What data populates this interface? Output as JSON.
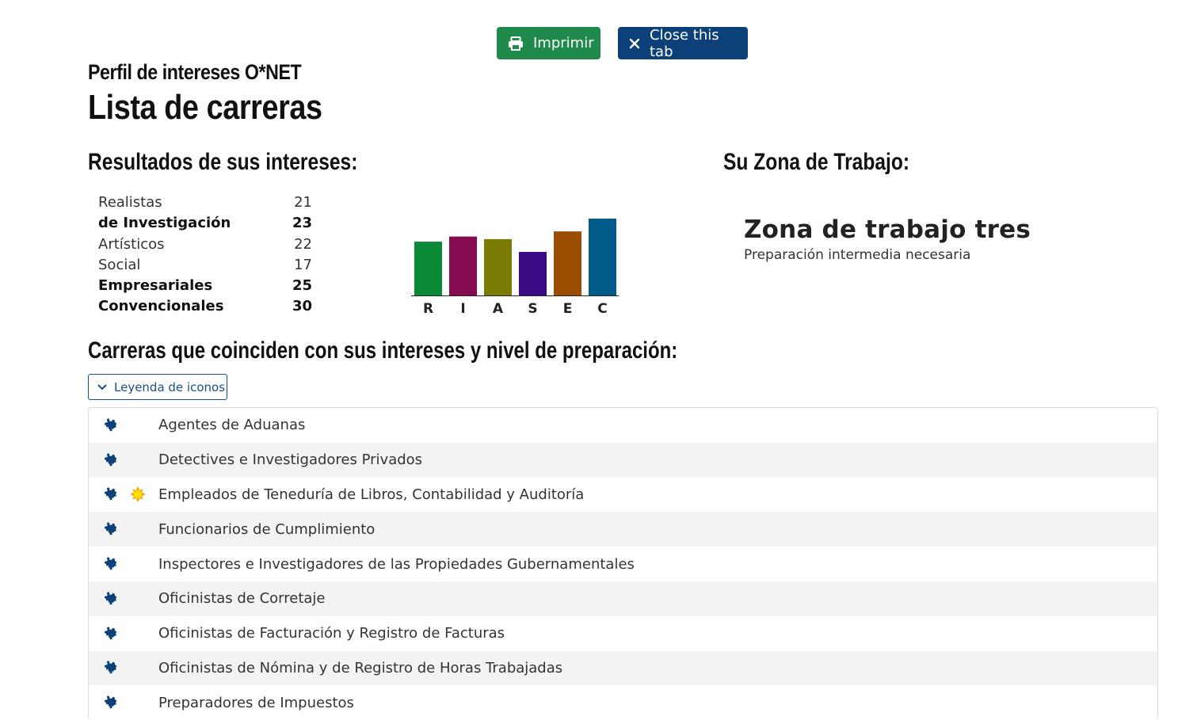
{
  "toolbar": {
    "print_label": "Imprimir",
    "close_label": "Close this tab"
  },
  "header": {
    "subtitle": "Perfil de intereses O*NET",
    "title": "Lista de carreras"
  },
  "results": {
    "heading": "Resultados de sus intereses:",
    "scores": [
      {
        "label": "Realistas",
        "value": "21",
        "bold": false
      },
      {
        "label": "de Investigación",
        "value": "23",
        "bold": true
      },
      {
        "label": "Artísticos",
        "value": "22",
        "bold": false
      },
      {
        "label": "Social",
        "value": "17",
        "bold": false
      },
      {
        "label": "Empresariales",
        "value": "25",
        "bold": true
      },
      {
        "label": "Convencionales",
        "value": "30",
        "bold": true
      }
    ]
  },
  "chart_data": {
    "type": "bar",
    "categories": [
      "R",
      "I",
      "A",
      "S",
      "E",
      "C"
    ],
    "values": [
      21,
      23,
      22,
      17,
      25,
      30
    ],
    "colors": [
      "#0a8a35",
      "#850a4f",
      "#7a7a05",
      "#3a0a85",
      "#9a4d00",
      "#005a8a"
    ],
    "ylim": [
      0,
      30
    ],
    "grid": false
  },
  "zone": {
    "heading": "Su Zona de Trabajo:",
    "title": "Zona de trabajo tres",
    "description": "Preparación intermedia necesaria"
  },
  "careers": {
    "heading": "Carreras que coinciden con sus intereses y nivel de preparación:",
    "legend_label": "Leyenda de iconos",
    "items": [
      {
        "label": "Agentes de Aduanas",
        "bright": false
      },
      {
        "label": "Detectives e Investigadores Privados",
        "bright": false
      },
      {
        "label": "Empleados de Teneduría de Libros, Contabilidad y Auditoría",
        "bright": true
      },
      {
        "label": "Funcionarios de Cumplimiento",
        "bright": false
      },
      {
        "label": "Inspectores e Investigadores de las Propiedades Gubernamentales",
        "bright": false
      },
      {
        "label": "Oficinistas de Corretaje",
        "bright": false
      },
      {
        "label": "Oficinistas de Facturación y Registro de Facturas",
        "bright": false
      },
      {
        "label": "Oficinistas de Nómina y de Registro de Horas Trabajadas",
        "bright": false
      },
      {
        "label": "Preparadores de Impuestos",
        "bright": false
      }
    ]
  },
  "icons": {
    "match": "puzzle-icon",
    "bright": "sun-icon",
    "print": "printer-icon",
    "close": "close-icon",
    "legend": "chevron-down-icon"
  }
}
